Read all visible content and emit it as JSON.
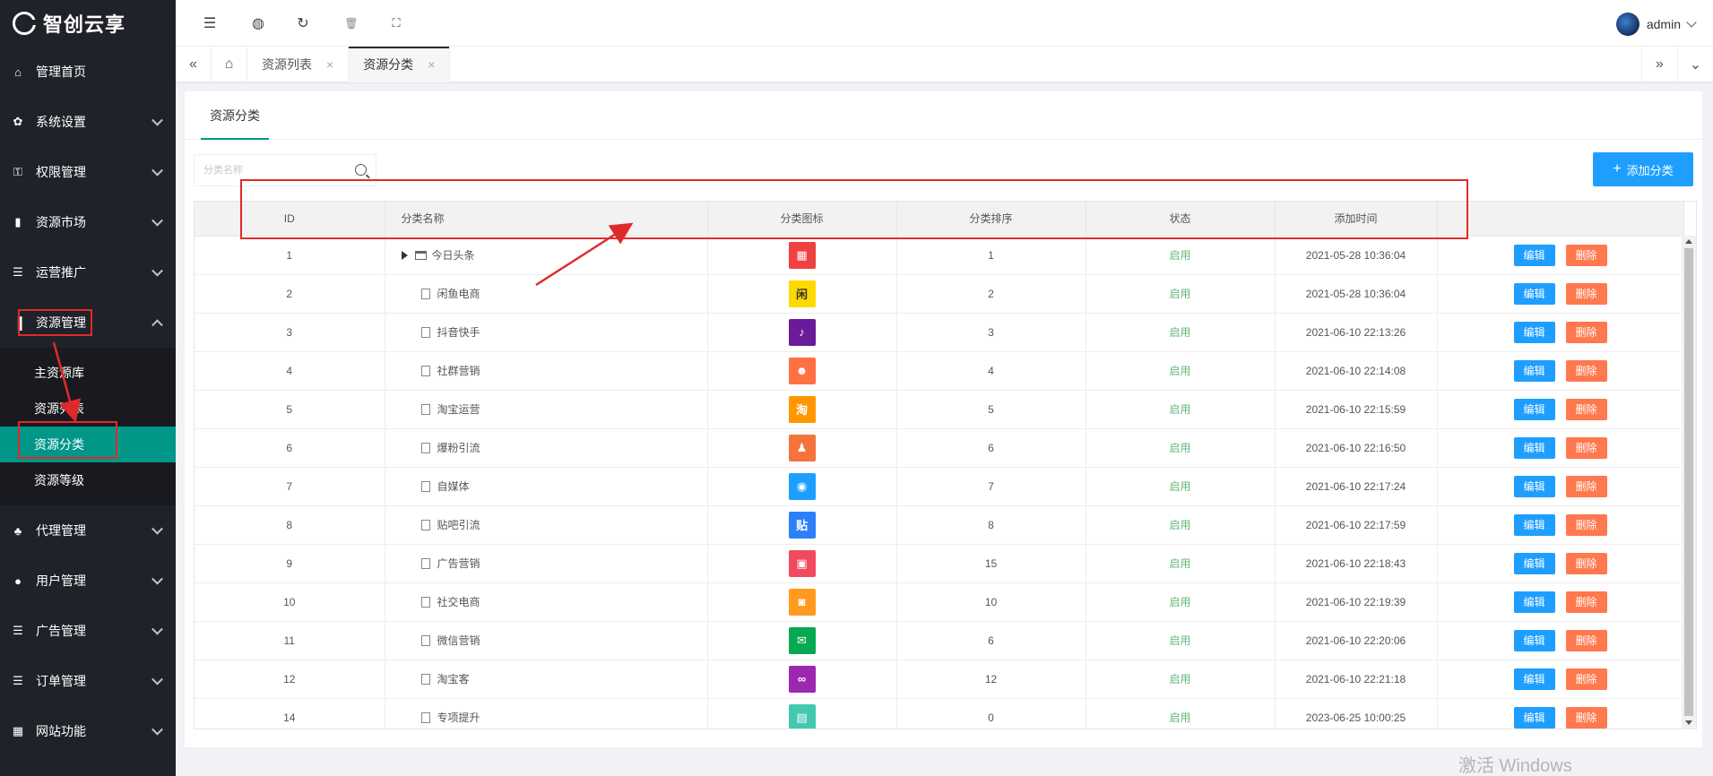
{
  "app": {
    "logo_text": "智创云享"
  },
  "sidebar": {
    "items": [
      {
        "label": "管理首页",
        "icon": "home-icon",
        "glyph": "⌂",
        "has_arrow": false
      },
      {
        "label": "系统设置",
        "icon": "gear-icon",
        "glyph": "✿",
        "has_arrow": true
      },
      {
        "label": "权限管理",
        "icon": "key-icon",
        "glyph": "⚿",
        "has_arrow": true
      },
      {
        "label": "资源市场",
        "icon": "book-icon",
        "glyph": "▮",
        "has_arrow": true
      },
      {
        "label": "运营推广",
        "icon": "list-icon",
        "glyph": "☰",
        "has_arrow": true
      },
      {
        "label": "资源管理",
        "icon": "chart-icon",
        "glyph": "▐",
        "has_arrow": true,
        "expanded": true
      },
      {
        "label": "代理管理",
        "icon": "sitemap-icon",
        "glyph": "♣",
        "has_arrow": true
      },
      {
        "label": "用户管理",
        "icon": "user-icon",
        "glyph": "●",
        "has_arrow": true
      },
      {
        "label": "广告管理",
        "icon": "list-icon",
        "glyph": "☰",
        "has_arrow": true
      },
      {
        "label": "订单管理",
        "icon": "list-icon",
        "glyph": "☰",
        "has_arrow": true
      },
      {
        "label": "网站功能",
        "icon": "grid-icon",
        "glyph": "▦",
        "has_arrow": true
      }
    ],
    "sub_items": [
      "主资源库",
      "资源列表",
      "资源分类",
      "资源等级"
    ],
    "active_sub": "资源分类"
  },
  "header": {
    "user_name": "admin"
  },
  "tabs": [
    {
      "label": "资源列表",
      "active": false
    },
    {
      "label": "资源分类",
      "active": true
    }
  ],
  "card": {
    "tab_label": "资源分类",
    "search_placeholder": "分类名称",
    "add_button": "添加分类"
  },
  "table": {
    "columns": [
      "ID",
      "分类名称",
      "分类图标",
      "分类排序",
      "状态",
      "添加时间"
    ],
    "edit_label": "编辑",
    "delete_label": "删除",
    "rows": [
      {
        "id": "1",
        "name": "今日头条",
        "parent": true,
        "icon_color": "#f04142",
        "icon_glyph": "▦",
        "sort": "1",
        "status": "启用",
        "time": "2021-05-28 10:36:04"
      },
      {
        "id": "2",
        "name": "闲鱼电商",
        "icon_color": "#ffda00",
        "icon_glyph": "闲",
        "sort": "2",
        "status": "启用",
        "time": "2021-05-28 10:36:04"
      },
      {
        "id": "3",
        "name": "抖音快手",
        "icon_color": "#6a1b9a",
        "icon_glyph": "♪",
        "sort": "3",
        "status": "启用",
        "time": "2021-06-10 22:13:26"
      },
      {
        "id": "4",
        "name": "社群营销",
        "icon_color": "#ff7043",
        "icon_glyph": "☻",
        "sort": "4",
        "status": "启用",
        "time": "2021-06-10 22:14:08"
      },
      {
        "id": "5",
        "name": "淘宝运营",
        "icon_color": "#ff9800",
        "icon_glyph": "淘",
        "sort": "5",
        "status": "启用",
        "time": "2021-06-10 22:15:59"
      },
      {
        "id": "6",
        "name": "爆粉引流",
        "icon_color": "#f4743b",
        "icon_glyph": "♟",
        "sort": "6",
        "status": "启用",
        "time": "2021-06-10 22:16:50"
      },
      {
        "id": "7",
        "name": "自媒体",
        "icon_color": "#1e9fff",
        "icon_glyph": "◉",
        "sort": "7",
        "status": "启用",
        "time": "2021-06-10 22:17:24"
      },
      {
        "id": "8",
        "name": "贴吧引流",
        "icon_color": "#2d7ff9",
        "icon_glyph": "贴",
        "sort": "8",
        "status": "启用",
        "time": "2021-06-10 22:17:59"
      },
      {
        "id": "9",
        "name": "广告营销",
        "icon_color": "#f04a5e",
        "icon_glyph": "▣",
        "sort": "15",
        "status": "启用",
        "time": "2021-06-10 22:18:43"
      },
      {
        "id": "10",
        "name": "社交电商",
        "icon_color": "#ff9a1f",
        "icon_glyph": "◙",
        "sort": "10",
        "status": "启用",
        "time": "2021-06-10 22:19:39"
      },
      {
        "id": "11",
        "name": "微信营销",
        "icon_color": "#07a852",
        "icon_glyph": "✉",
        "sort": "6",
        "status": "启用",
        "time": "2021-06-10 22:20:06"
      },
      {
        "id": "12",
        "name": "淘宝客",
        "icon_color": "#9c27b0",
        "icon_glyph": "∞",
        "sort": "12",
        "status": "启用",
        "time": "2021-06-10 22:21:18"
      },
      {
        "id": "14",
        "name": "专项提升",
        "icon_color": "#45c8b0",
        "icon_glyph": "▤",
        "sort": "0",
        "status": "启用",
        "time": "2023-06-25 10:00:25"
      }
    ]
  },
  "watermark": "激活 Windows",
  "colors": {
    "sidebar_bg": "#20222a",
    "accent": "#009688",
    "primary": "#1e9fff",
    "danger": "#ff5722",
    "annotation": "#e02a2a"
  }
}
